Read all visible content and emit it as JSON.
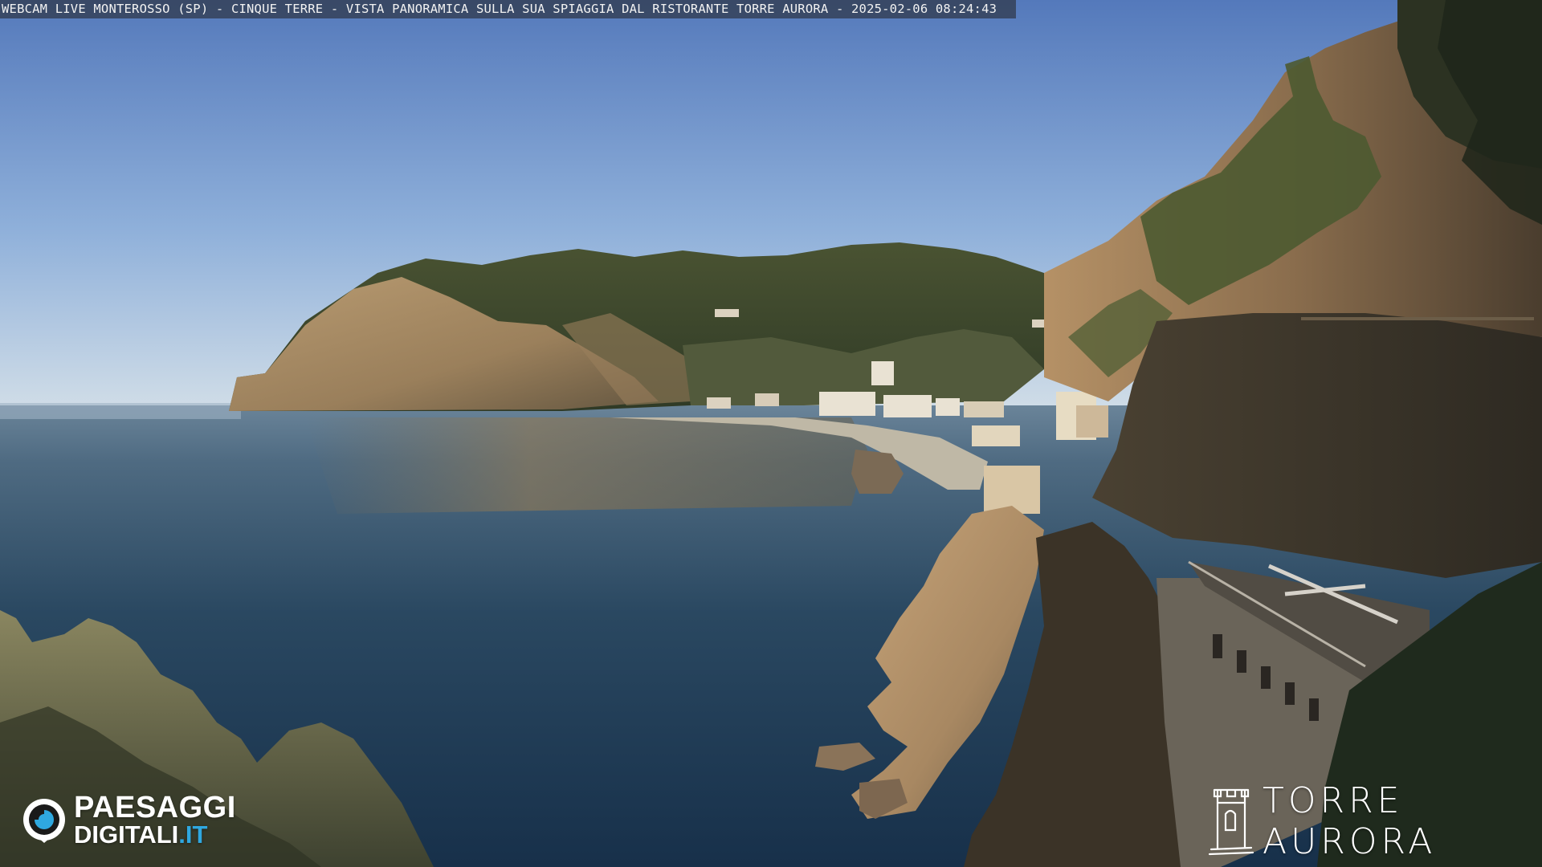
{
  "caption": {
    "text": "WEBCAM LIVE MONTEROSSO (SP) - CINQUE TERRE - VISTA PANORAMICA SULLA SUA SPIAGGIA DAL RISTORANTE TORRE AURORA - 2025-02-06 08:24:43"
  },
  "logos": {
    "left": {
      "line1": "PAESAGGI",
      "line2_main": "DIGITALI",
      "line2_tld": ".IT",
      "icon": "camera-lens-icon"
    },
    "right": {
      "name": "TORRE AURORA",
      "icon": "tower-sketch-icon"
    }
  },
  "colors": {
    "sky_top": "#5b84c2",
    "sky_horizon": "#c6d6e4",
    "sea_far": "#5f7b90",
    "sea_near": "#1b3347",
    "hill_green": "#3f4a2e",
    "cliff_sunlit": "#b8946a",
    "cliff_shadow": "#3a3226",
    "logo_accent": "#2fa8e0"
  }
}
